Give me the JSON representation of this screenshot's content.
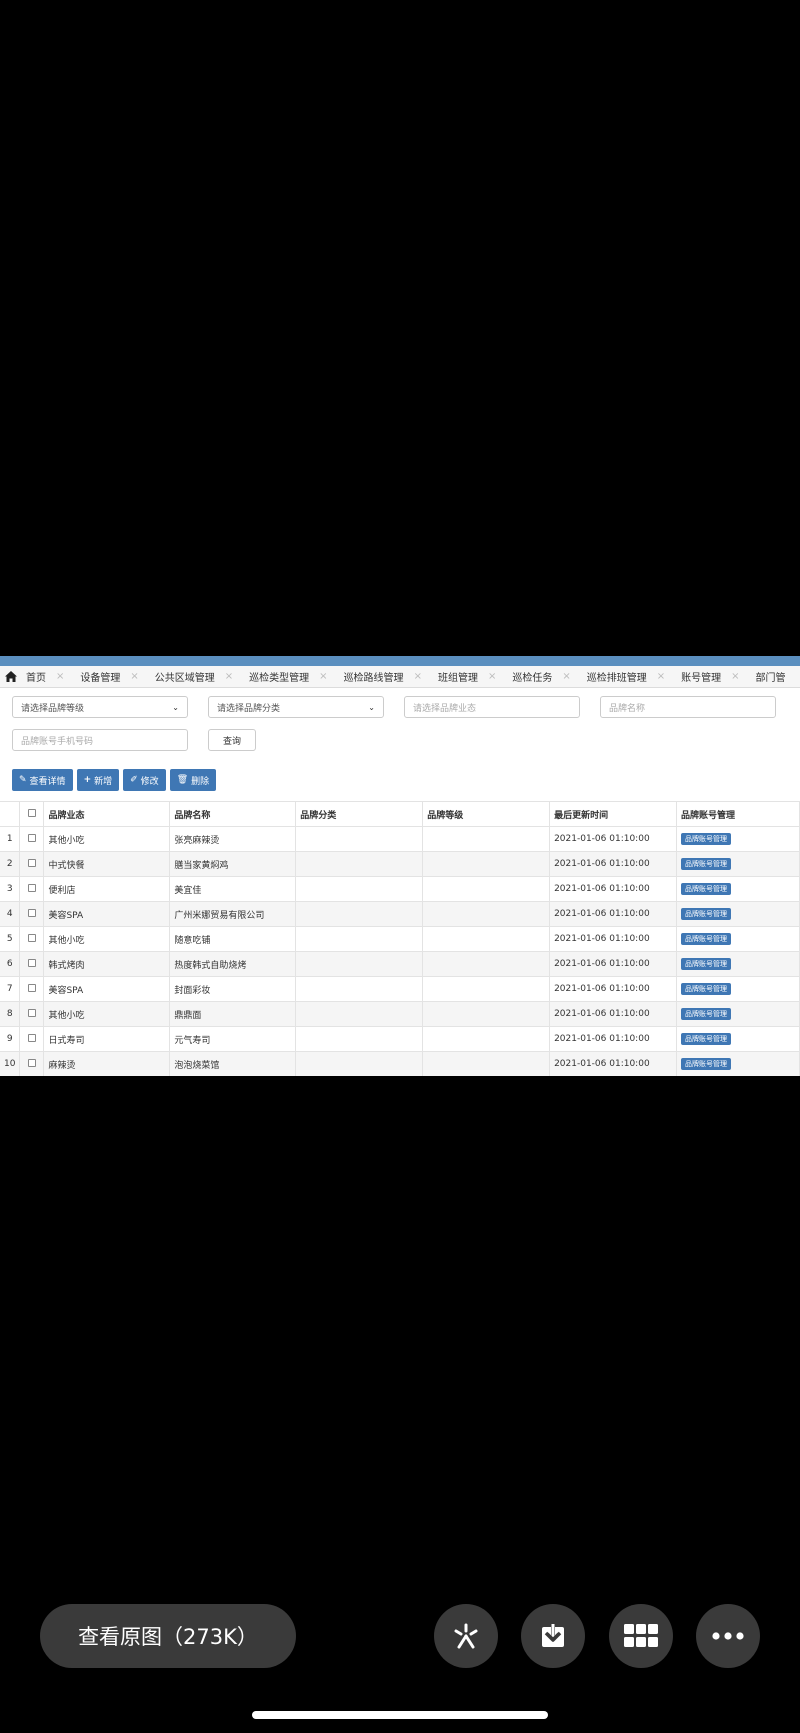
{
  "tabs": [
    {
      "label": "首页"
    },
    {
      "label": "设备管理"
    },
    {
      "label": "公共区域管理"
    },
    {
      "label": "巡检类型管理"
    },
    {
      "label": "巡检路线管理"
    },
    {
      "label": "班组管理"
    },
    {
      "label": "巡检任务"
    },
    {
      "label": "巡检排班管理"
    },
    {
      "label": "账号管理"
    },
    {
      "label": "部门管"
    }
  ],
  "filters": {
    "level_placeholder": "请选择品牌等级",
    "category_placeholder": "请选择品牌分类",
    "format_placeholder": "请选择品牌业态",
    "name_placeholder": "品牌名称",
    "phone_placeholder": "品牌账号手机号码",
    "query_label": "查询"
  },
  "toolbar": {
    "detail_label": "查看详情",
    "add_label": "新增",
    "edit_label": "修改",
    "delete_label": "删除"
  },
  "table": {
    "columns": [
      "品牌业态",
      "品牌名称",
      "品牌分类",
      "品牌等级",
      "最后更新时间",
      "品牌账号管理"
    ],
    "rows": [
      {
        "num": "1",
        "format": "其他小吃",
        "name": "张亮麻辣烫",
        "category": "",
        "level": "",
        "time": "2021-01-06 01:10:00",
        "action": "品牌账号管理"
      },
      {
        "num": "2",
        "format": "中式快餐",
        "name": "膳当家黄焖鸡",
        "category": "",
        "level": "",
        "time": "2021-01-06 01:10:00",
        "action": "品牌账号管理"
      },
      {
        "num": "3",
        "format": "便利店",
        "name": "美宜佳",
        "category": "",
        "level": "",
        "time": "2021-01-06 01:10:00",
        "action": "品牌账号管理"
      },
      {
        "num": "4",
        "format": "美容SPA",
        "name": "广州米娜贸易有限公司",
        "category": "",
        "level": "",
        "time": "2021-01-06 01:10:00",
        "action": "品牌账号管理"
      },
      {
        "num": "5",
        "format": "其他小吃",
        "name": "随意吃铺",
        "category": "",
        "level": "",
        "time": "2021-01-06 01:10:00",
        "action": "品牌账号管理"
      },
      {
        "num": "6",
        "format": "韩式烤肉",
        "name": "热度韩式自助烧烤",
        "category": "",
        "level": "",
        "time": "2021-01-06 01:10:00",
        "action": "品牌账号管理"
      },
      {
        "num": "7",
        "format": "美容SPA",
        "name": "封面彩妆",
        "category": "",
        "level": "",
        "time": "2021-01-06 01:10:00",
        "action": "品牌账号管理"
      },
      {
        "num": "8",
        "format": "其他小吃",
        "name": "鼎鼎面",
        "category": "",
        "level": "",
        "time": "2021-01-06 01:10:00",
        "action": "品牌账号管理"
      },
      {
        "num": "9",
        "format": "日式寿司",
        "name": "元气寿司",
        "category": "",
        "level": "",
        "time": "2021-01-06 01:10:00",
        "action": "品牌账号管理"
      },
      {
        "num": "10",
        "format": "麻辣烫",
        "name": "泡泡烧菜馆",
        "category": "",
        "level": "",
        "time": "2021-01-06 01:10:00",
        "action": "品牌账号管理"
      }
    ]
  },
  "viewer": {
    "original_label": "查看原图（273K）"
  },
  "colors": {
    "accent": "#3f77b4",
    "topbar": "#5b8fbf",
    "viewer_button": "#3a3a3a"
  }
}
